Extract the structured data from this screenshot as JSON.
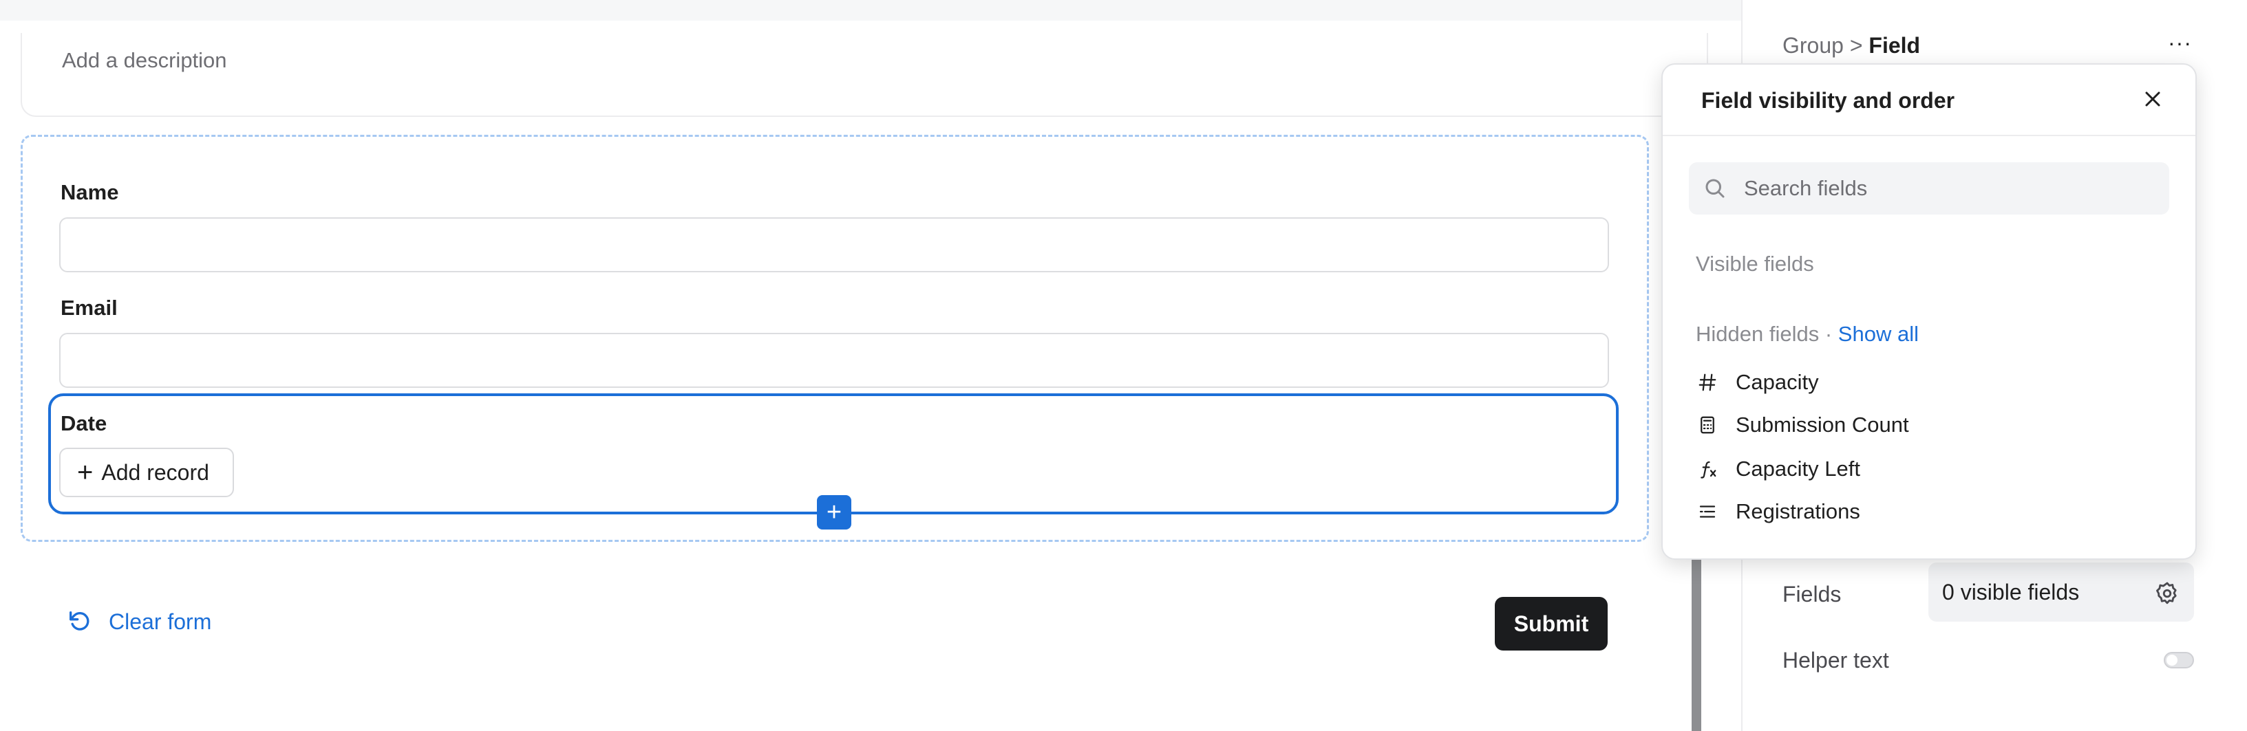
{
  "form": {
    "description_placeholder": "Add a description",
    "fields": [
      {
        "label": "Name"
      },
      {
        "label": "Email"
      },
      {
        "label": "Date"
      }
    ],
    "add_record_label": "Add record",
    "clear_form_label": "Clear form",
    "submit_label": "Submit"
  },
  "panel": {
    "breadcrumb_parent": "Group",
    "breadcrumb_separator": ">",
    "breadcrumb_current": "Field",
    "more_label": "···",
    "fields_label": "Fields",
    "fields_value": "0 visible fields",
    "helper_text_label": "Helper text",
    "helper_text_enabled": false
  },
  "popover": {
    "title": "Field visibility and order",
    "search_placeholder": "Search fields",
    "visible_fields_label": "Visible fields",
    "hidden_fields_label": "Hidden fields",
    "hidden_separator": "·",
    "show_all_label": "Show all",
    "hidden_fields": [
      {
        "icon": "number-icon",
        "label": "Capacity"
      },
      {
        "icon": "calculator-icon",
        "label": "Submission Count"
      },
      {
        "icon": "formula-icon",
        "label": "Capacity Left"
      },
      {
        "icon": "link-icon",
        "label": "Registrations"
      }
    ]
  },
  "colors": {
    "accent": "#1c6fd8",
    "submit_bg": "#1b1c1e",
    "dashed_border": "#a6c8f2"
  }
}
